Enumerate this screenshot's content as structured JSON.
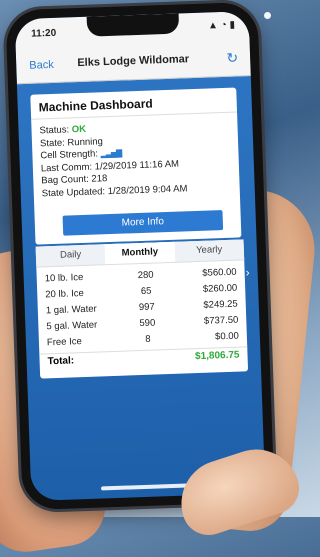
{
  "status_bar": {
    "time": "11:20",
    "right_icons": "▲ ◔ ▮"
  },
  "navbar": {
    "back": "Back",
    "title": "Elks Lodge Wildomar",
    "refresh_icon": "refresh-icon"
  },
  "dashboard": {
    "title": "Machine Dashboard",
    "status_label": "Status:",
    "status_value": "OK",
    "state": "State: Running",
    "cell_label": "Cell Strength:",
    "last_comm": "Last Comm: 1/29/2019 11:16 AM",
    "bag_count": "Bag Count: 218",
    "state_updated": "State Updated: 1/28/2019 9:04 AM",
    "more_info": "More Info"
  },
  "sales": {
    "tabs": [
      "Daily",
      "Monthly",
      "Yearly"
    ],
    "rows": [
      {
        "item": "10 lb. Ice",
        "qty": "280",
        "amount": "$560.00"
      },
      {
        "item": "20 lb. Ice",
        "qty": "65",
        "amount": "$260.00"
      },
      {
        "item": "1 gal. Water",
        "qty": "997",
        "amount": "$249.25"
      },
      {
        "item": "5 gal. Water",
        "qty": "590",
        "amount": "$737.50"
      },
      {
        "item": "Free Ice",
        "qty": "8",
        "amount": "$0.00"
      }
    ],
    "total_label": "Total:",
    "total_value": "$1,806.75"
  },
  "colors": {
    "accent": "#2d7ad3",
    "ok": "#2eab3a",
    "screen_bg": "#1e5fa9"
  }
}
